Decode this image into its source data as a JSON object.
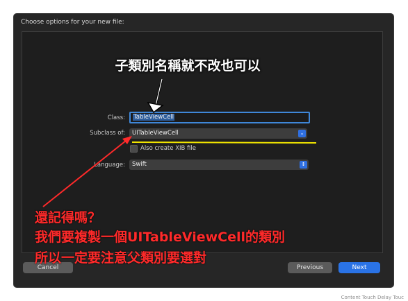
{
  "dialog": {
    "title": "Choose options for your new file:"
  },
  "form": {
    "class_label": "Class:",
    "class_value": "TableViewCell",
    "subclass_label": "Subclass of:",
    "subclass_value": "UITableViewCell",
    "xib_label": "Also create XIB file",
    "xib_checked": false,
    "language_label": "Language:",
    "language_value": "Swift"
  },
  "buttons": {
    "cancel": "Cancel",
    "previous": "Previous",
    "next": "Next"
  },
  "annotations": {
    "top_note": "子類別名稱就不改也可以",
    "red_line1": "還記得嗎？",
    "red_line2": "我們要複製一個UITableViewCell的類別",
    "red_line3": "所以一定要注意父類別要選對"
  },
  "background_fragment": "Content Touch  Delay Touc",
  "colors": {
    "accent": "#2a73e6",
    "annotation_red": "#ff2a2a",
    "highlight_yellow": "#f0e400"
  }
}
